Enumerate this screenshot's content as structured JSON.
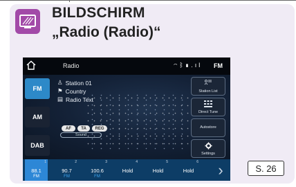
{
  "header": {
    "icon": "screen-icon",
    "title_line1": "BILDSCHIRM",
    "title_line2": "„Radio (Radio)“"
  },
  "screen": {
    "status_bar": {
      "home_icon": "home-icon",
      "title": "Radio",
      "icons": [
        "wifi-icon",
        "bluetooth-icon",
        "phone-icon",
        "signal-icon"
      ],
      "band": "FM"
    },
    "bands": [
      "FM",
      "AM",
      "DAB"
    ],
    "active_band": "FM",
    "station": "Station 01",
    "country": "Country",
    "radio_text": "Radio Text",
    "pills": [
      "AF",
      "TA",
      "REG"
    ],
    "sound_label": "Sound",
    "right_buttons": [
      {
        "label": "Station List",
        "icon": "station-list-icon"
      },
      {
        "label": "Direct Tune",
        "icon": "keypad-icon"
      },
      {
        "label": "Autostore",
        "icon": ""
      },
      {
        "label": "Settings",
        "icon": "gear-icon"
      }
    ],
    "presets": [
      {
        "num": "1",
        "freq": "88.1",
        "band": "FM",
        "active": true
      },
      {
        "num": "2",
        "freq": "90.7",
        "band": "FM",
        "active": false
      },
      {
        "num": "3",
        "freq": "100.6",
        "band": "FM",
        "active": false
      },
      {
        "num": "4",
        "freq": "Hold",
        "band": "",
        "active": false
      },
      {
        "num": "5",
        "freq": "Hold",
        "band": "",
        "active": false
      },
      {
        "num": "6",
        "freq": "Hold",
        "band": "",
        "active": false
      }
    ],
    "next_icon": "chevron-right-icon"
  },
  "page_ref": "S. 26",
  "colors": {
    "card_bg": "#f0ebf5",
    "icon_bg": "#a24aa8",
    "active_band": "#2d89c8",
    "preset_bar": "#0d3d66",
    "active_preset": "#2d87d6"
  }
}
